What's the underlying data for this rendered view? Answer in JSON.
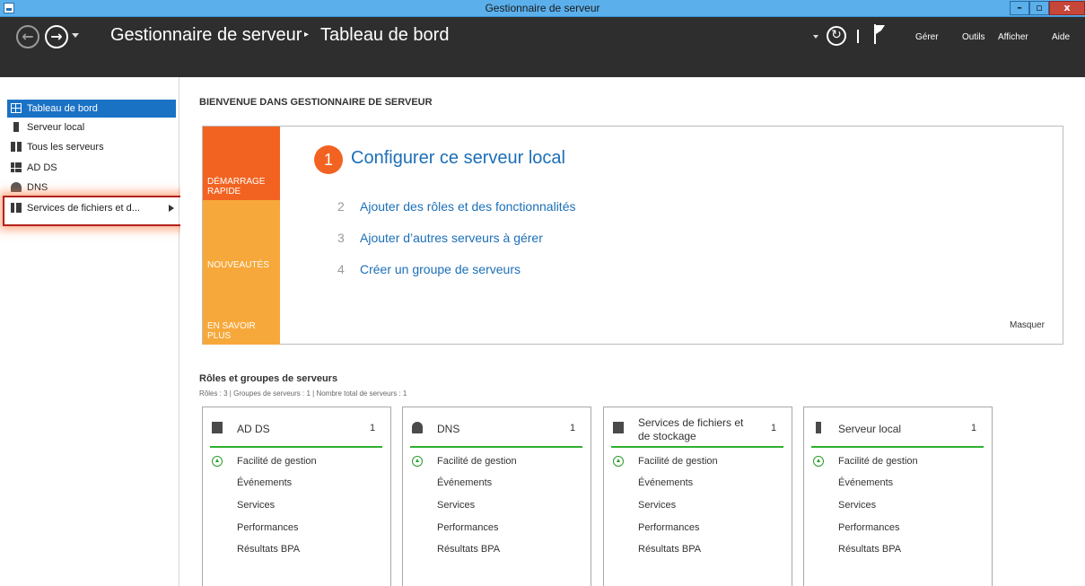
{
  "window": {
    "title": "Gestionnaire de serveur",
    "controls": {
      "minimize": "–",
      "maximize": "▫",
      "close": "x"
    }
  },
  "header": {
    "breadcrumb_root": "Gestionnaire de serveur",
    "breadcrumb_separator": "▸",
    "breadcrumb_page": "Tableau de bord",
    "back_glyph": "←",
    "forward_glyph": "→",
    "refresh_glyph": "↻",
    "menus": {
      "manage": "Gérer",
      "tools": "Outils",
      "view": "Afficher",
      "help": "Aide"
    }
  },
  "sidebar": {
    "items": [
      {
        "label": "Tableau de bord",
        "icon": "dashboard-icon",
        "active": true
      },
      {
        "label": "Serveur local",
        "icon": "server-icon"
      },
      {
        "label": "Tous les serveurs",
        "icon": "all-servers-icon"
      },
      {
        "label": "AD DS",
        "icon": "ad-ds-icon"
      },
      {
        "label": "DNS",
        "icon": "dns-icon"
      },
      {
        "label": "Services de fichiers et d...",
        "icon": "file-services-icon",
        "highlighted": true
      }
    ]
  },
  "main": {
    "welcome_title": "BIENVENUE DANS GESTIONNAIRE DE SERVEUR",
    "quick_start": {
      "tabs": [
        "DÉMARRAGE RAPIDE",
        "NOUVEAUTÉS",
        "EN SAVOIR PLUS"
      ],
      "steps": [
        {
          "num": "1",
          "label": "Configurer ce serveur local"
        },
        {
          "num": "2",
          "label": "Ajouter des rôles et des fonctionnalités"
        },
        {
          "num": "3",
          "label": "Ajouter d’autres serveurs à gérer"
        },
        {
          "num": "4",
          "label": "Créer un groupe de serveurs"
        }
      ],
      "hide_label": "Masquer",
      "accent_color": "#f26322",
      "secondary_color": "#f7a83a"
    },
    "roles": {
      "title": "Rôles et groupes de serveurs",
      "summary": "Rôles : 3  |  Groupes de serveurs : 1  |  Nombre total de serveurs : 1",
      "cards": [
        {
          "title": "AD DS",
          "count": "1",
          "icon": "ad-ds-icon",
          "rows": [
            "Facilité de gestion",
            "Événements",
            "Services",
            "Performances",
            "Résultats BPA"
          ]
        },
        {
          "title": "DNS",
          "count": "1",
          "icon": "dns-icon",
          "rows": [
            "Facilité de gestion",
            "Événements",
            "Services",
            "Performances",
            "Résultats BPA"
          ]
        },
        {
          "title": "Services de fichiers et de stockage",
          "count": "1",
          "icon": "file-services-icon",
          "rows": [
            "Facilité de gestion",
            "Événements",
            "Services",
            "Performances",
            "Résultats BPA"
          ]
        },
        {
          "title": "Serveur local",
          "count": "1",
          "icon": "server-icon",
          "rows": [
            "Facilité de gestion",
            "Événements",
            "Services",
            "Performances",
            "Résultats BPA"
          ]
        }
      ],
      "status_color": "#2fb12f"
    }
  }
}
